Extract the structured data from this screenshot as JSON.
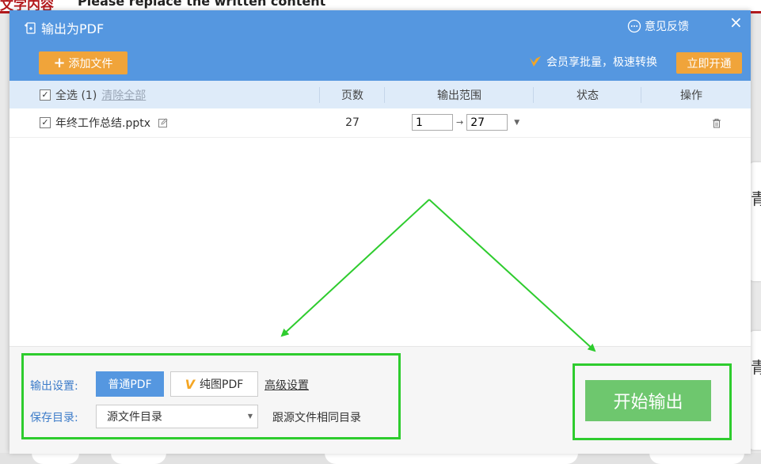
{
  "background": {
    "top_heading": "文字内容",
    "top_subtitle": "Please replace the written content",
    "side_big_char": "青"
  },
  "dialog": {
    "title": "输出为PDF",
    "feedback_label": "意见反馈",
    "close_label": "×",
    "add_file_label": "添加文件",
    "vip_promo_text": "会员享批量，极速转换",
    "open_now_label": "立即开通"
  },
  "table": {
    "select_all_label": "全选 (1)",
    "clear_all_label": "清除全部",
    "columns": {
      "pages": "页数",
      "range": "输出范围",
      "status": "状态",
      "action": "操作"
    },
    "rows": [
      {
        "filename": "年终工作总结.pptx",
        "pages": "27",
        "range_from": "1",
        "range_to": "27",
        "status": ""
      }
    ]
  },
  "settings": {
    "output_label": "输出设置:",
    "normal_pdf_label": "普通PDF",
    "image_pdf_label": "纯图PDF",
    "advanced_label": "高级设置",
    "save_dir_label": "保存目录:",
    "save_dir_value": "源文件目录",
    "save_dir_note": "跟源文件相同目录",
    "start_label": "开始输出"
  },
  "colors": {
    "titlebar": "#5597e0",
    "orange": "#f0a43a",
    "start_green": "#6ec76e",
    "annotation_green": "#2ecc2e"
  }
}
